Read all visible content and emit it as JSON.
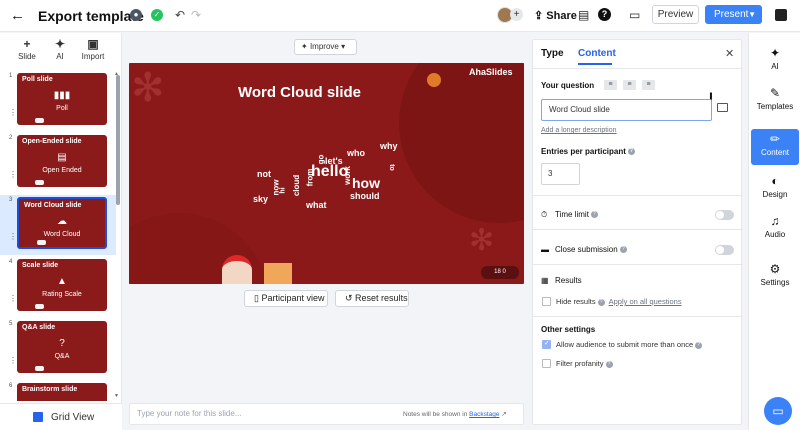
{
  "topbar": {
    "back_icon": "arrow-left-icon",
    "title": "Export template",
    "share_label": "Share",
    "preview_label": "Preview",
    "present_label": "Present",
    "avatar_plus": "+"
  },
  "left_panel": {
    "tools": [
      {
        "label": "Slide",
        "icon": "+"
      },
      {
        "label": "AI",
        "icon": "✦"
      },
      {
        "label": "Import",
        "icon": "▣"
      }
    ],
    "slides": [
      {
        "num": "1",
        "title": "Poll slide",
        "type": "Poll",
        "icon": "▮▮▮"
      },
      {
        "num": "2",
        "title": "Open-Ended slide",
        "type": "Open Ended",
        "icon": "▤"
      },
      {
        "num": "3",
        "title": "Word Cloud slide",
        "type": "Word Cloud",
        "icon": "☁"
      },
      {
        "num": "4",
        "title": "Scale slide",
        "type": "Rating Scale",
        "icon": "▲"
      },
      {
        "num": "5",
        "title": "Q&A slide",
        "type": "Q&A",
        "icon": "?"
      },
      {
        "num": "6",
        "title": "Brainstorm slide",
        "type": "",
        "icon": ""
      }
    ],
    "grid_view_label": "Grid View"
  },
  "editor": {
    "improve_label": "Improve",
    "slide_title": "Word Cloud slide",
    "logo_text": "AhaSlides",
    "counts_text": "18  0",
    "participant_view_label": "Participant view",
    "reset_results_label": "Reset results",
    "notes_placeholder": "Type your note for this slide...",
    "notes_hint": "Notes will be shown in",
    "notes_hint_link": "Backstage"
  },
  "word_cloud": [
    {
      "text": "hello",
      "size": 16
    },
    {
      "text": "how",
      "size": 14
    },
    {
      "text": "who",
      "size": 9
    },
    {
      "text": "why",
      "size": 9
    },
    {
      "text": "let's",
      "size": 9
    },
    {
      "text": "not",
      "size": 9
    },
    {
      "text": "should",
      "size": 9
    },
    {
      "text": "what",
      "size": 9
    },
    {
      "text": "sky",
      "size": 9
    },
    {
      "text": "go",
      "size": 8
    },
    {
      "text": "work",
      "size": 8
    },
    {
      "text": "now",
      "size": 8
    },
    {
      "text": "from",
      "size": 8
    },
    {
      "text": "cloud",
      "size": 8
    },
    {
      "text": "hi",
      "size": 7
    },
    {
      "text": "to",
      "size": 7
    }
  ],
  "properties": {
    "tab_type": "Type",
    "tab_content": "Content",
    "question_label": "Your question",
    "question_value": "Word Cloud slide",
    "add_description": "Add a longer description",
    "entries_label": "Entries per participant",
    "entries_value": "3",
    "time_limit_label": "Time limit",
    "close_submission_label": "Close submission",
    "results_label": "Results",
    "hide_results_label": "Hide results",
    "apply_all_label": "Apply on all questions",
    "other_settings_label": "Other settings",
    "allow_more_label": "Allow audience to submit more than once",
    "filter_profanity_label": "Filter profanity"
  },
  "right_sidebar": [
    {
      "label": "AI",
      "icon": "✦"
    },
    {
      "label": "Templates",
      "icon": "✎"
    },
    {
      "label": "Content",
      "icon": "✏"
    },
    {
      "label": "Design",
      "icon": "◐"
    },
    {
      "label": "Audio",
      "icon": "♫"
    },
    {
      "label": "Settings",
      "icon": "⚙"
    }
  ],
  "colors": {
    "accent": "#3b82f6",
    "slide_bg": "#8c1919"
  }
}
